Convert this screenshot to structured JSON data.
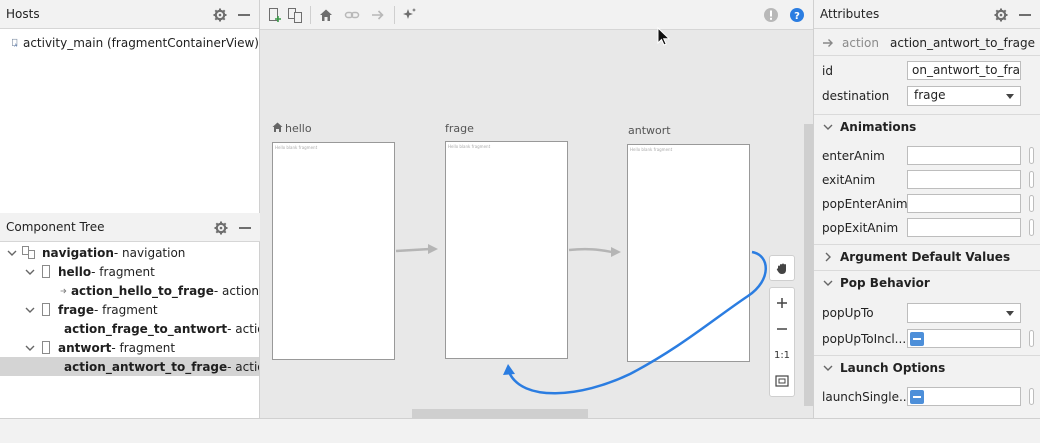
{
  "hosts": {
    "title": "Hosts",
    "items": [
      {
        "label": "activity_main (fragmentContainerView)"
      }
    ]
  },
  "component_tree": {
    "title": "Component Tree",
    "root": {
      "name": "navigation",
      "suffix": " - navigation"
    },
    "nodes": [
      {
        "name": "hello",
        "suffix": " - fragment",
        "action": {
          "name": "action_hello_to_frage",
          "suffix": " - action"
        }
      },
      {
        "name": "frage",
        "suffix": " - fragment",
        "action": {
          "name": "action_frage_to_antwort",
          "suffix": " - actio"
        }
      },
      {
        "name": "antwort",
        "suffix": " - fragment",
        "action": {
          "name": "action_antwort_to_frage",
          "suffix": " - actio"
        }
      }
    ]
  },
  "canvas": {
    "destinations": [
      {
        "label": "hello",
        "is_start": true
      },
      {
        "label": "frage",
        "is_start": false
      },
      {
        "label": "antwort",
        "is_start": false
      }
    ],
    "screen_text": "Hello blank fragment",
    "zoom": {
      "fit_label": "1:1"
    }
  },
  "attributes": {
    "title": "Attributes",
    "header_type": "action",
    "header_name": "action_antwort_to_frage",
    "id_label": "id",
    "id_value": "on_antwort_to_frage",
    "destination_label": "destination",
    "destination_value": "frage",
    "sections": {
      "animations": "Animations",
      "argument_defaults": "Argument Default Values",
      "pop_behavior": "Pop Behavior",
      "launch_options": "Launch Options"
    },
    "anim_fields": [
      "enterAnim",
      "exitAnim",
      "popEnterAnim",
      "popExitAnim"
    ],
    "pop_fields": {
      "pop_up_to": "popUpTo",
      "pop_up_to_inclusive": "popUpToIncl..."
    },
    "launch_fields": {
      "launch_single_top": "launchSingle..."
    }
  },
  "colors": {
    "accent": "#2b7de1",
    "selection": "#d4d4d4",
    "canvas_bg": "#e8e8e8",
    "arrow_gray": "#b5b5b5"
  }
}
